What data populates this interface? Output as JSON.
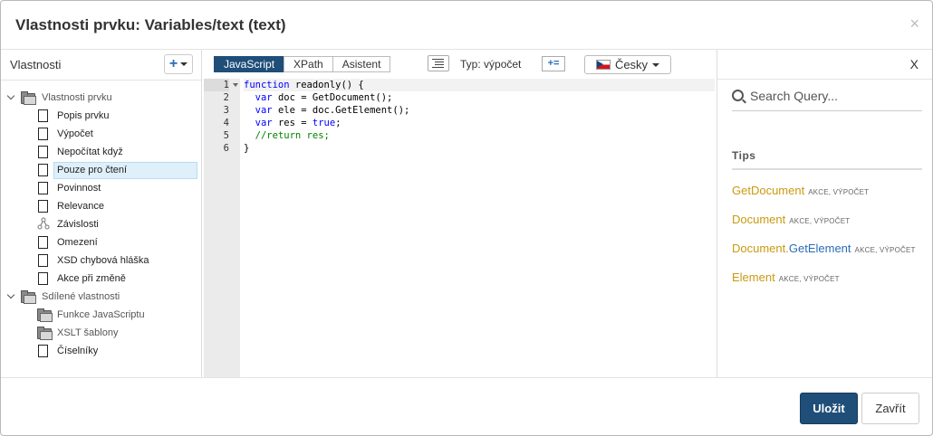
{
  "dialog": {
    "title": "Vlastnosti prvku: Variables/text (text)",
    "close_icon": "×"
  },
  "left": {
    "title": "Vlastnosti",
    "add_label": "+",
    "tree": [
      {
        "label": "Vlastnosti prvku",
        "type": "folder",
        "level": 0,
        "expanded": true
      },
      {
        "label": "Popis prvku",
        "type": "doc",
        "level": 1
      },
      {
        "label": "Výpočet",
        "type": "doc",
        "level": 1
      },
      {
        "label": "Nepočítat když",
        "type": "doc",
        "level": 1
      },
      {
        "label": "Pouze pro čtení",
        "type": "doc",
        "level": 1,
        "selected": true
      },
      {
        "label": "Povinnost",
        "type": "doc",
        "level": 1
      },
      {
        "label": "Relevance",
        "type": "doc",
        "level": 1
      },
      {
        "label": "Závislosti",
        "type": "deps",
        "level": 1
      },
      {
        "label": "Omezení",
        "type": "doc",
        "level": 1
      },
      {
        "label": "XSD chybová hláška",
        "type": "doc",
        "level": 1
      },
      {
        "label": "Akce při změně",
        "type": "doc",
        "level": 1
      },
      {
        "label": "Sdílené vlastnosti",
        "type": "folder",
        "level": 0,
        "expanded": true
      },
      {
        "label": "Funkce JavaScriptu",
        "type": "folder",
        "level": 1
      },
      {
        "label": "XSLT šablony",
        "type": "folder",
        "level": 1
      },
      {
        "label": "Číselníky",
        "type": "doc",
        "level": 1
      }
    ]
  },
  "toolbar": {
    "tabs": [
      "JavaScript",
      "XPath",
      "Asistent"
    ],
    "active_tab": "JavaScript",
    "type_label": "Typ:",
    "type_value": "výpočet",
    "type_button": "+=",
    "language": "Česky"
  },
  "editor": {
    "line_numbers": [
      "1",
      "2",
      "3",
      "4",
      "5",
      "6"
    ],
    "active_line": 1,
    "lines": [
      "function readonly() {",
      "  var doc = GetDocument();",
      "  var ele = doc.GetElement();",
      "  var res = true;",
      "  //return res;",
      "}"
    ]
  },
  "right": {
    "close_label": "X",
    "search_placeholder": "Search Query...",
    "tips_heading": "Tips",
    "tips": [
      {
        "name": "GetDocument",
        "name2": "",
        "tags": "akce, výpočet"
      },
      {
        "name": "Document",
        "name2": "",
        "tags": "akce, výpočet"
      },
      {
        "name": "Document.",
        "name2": "GetElement",
        "tags": "akce, výpočet"
      },
      {
        "name": "Element",
        "name2": "",
        "tags": "akce, výpočet"
      }
    ]
  },
  "footer": {
    "save_label": "Uložit",
    "cancel_label": "Zavřít"
  },
  "colors": {
    "primary": "#1f4e79",
    "tip_name": "#c99a10",
    "tip_method": "#2a6db5",
    "selection": "#dff0fb"
  }
}
